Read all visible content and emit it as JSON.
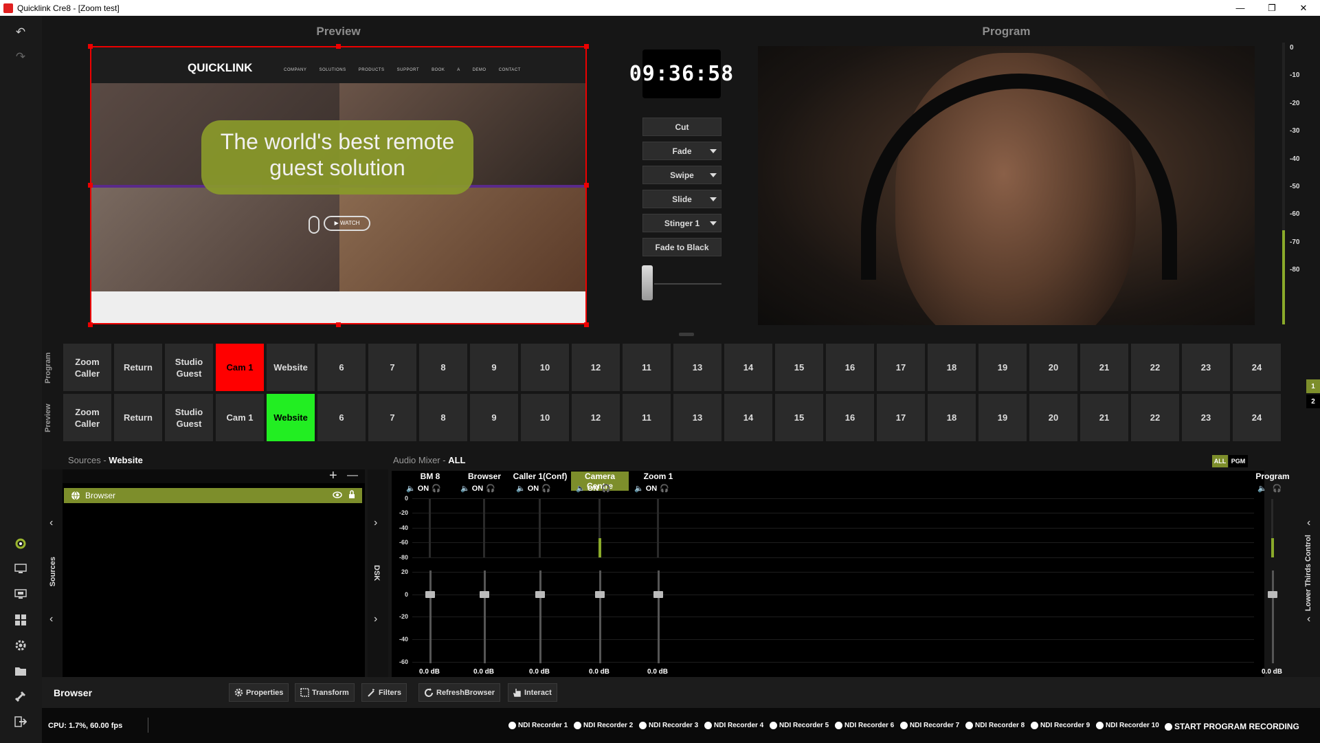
{
  "window": {
    "title": "Quicklink Cre8  - [Zoom test]",
    "minimize": "—",
    "maximize": "❐",
    "close": "✕"
  },
  "left_toolbar": {
    "undo": "↶",
    "redo": "↷"
  },
  "preview": {
    "title": "Preview",
    "site_logo": "QUICKLINK",
    "site_nav": "COMPANY SOLUTIONS PRODUCTS SUPPORT BOOK A DEMO CONTACT",
    "headline": "The world's best remote guest solution",
    "watch_button": "▶ WATCH"
  },
  "program": {
    "title": "Program"
  },
  "clock": "09:36:58",
  "transitions": {
    "cut": "Cut",
    "fade": "Fade",
    "swipe": "Swipe",
    "slide": "Slide",
    "stinger": "Stinger 1",
    "fade_to_black": "Fade to Black",
    "tbar_level": 0
  },
  "vu_scale": [
    "0",
    "-10",
    "-20",
    "-30",
    "-40",
    "-50",
    "-60",
    "-70",
    "-80"
  ],
  "program_level_db": -56,
  "grid": {
    "program_label": "Program",
    "preview_label": "Preview",
    "buttons": [
      "Zoom Caller",
      "Return",
      "Studio Guest",
      "Cam 1",
      "Website",
      "6",
      "7",
      "8",
      "9",
      "10",
      "12",
      "11",
      "13",
      "14",
      "15",
      "16",
      "17",
      "18",
      "19",
      "20",
      "21",
      "22",
      "23",
      "24"
    ],
    "program_active": "Cam 1",
    "preview_active": "Website",
    "program_color": "#ff0000",
    "preview_color": "#22ee22",
    "pages": [
      "1",
      "2"
    ]
  },
  "sources": {
    "label": "Sources",
    "scene": "Website",
    "sidebar_label": "Sources",
    "add": "+",
    "remove": "—",
    "items": [
      {
        "name": "Browser"
      }
    ]
  },
  "dsk_label": "DSK",
  "lower_thirds_label": "Lower Thirds Control",
  "audio": {
    "label": "Audio Mixer",
    "filter": "ALL",
    "tabs": [
      "ALL",
      "PGM"
    ],
    "on_label": "ON",
    "meter_scale": [
      "0",
      "-20",
      "-40",
      "-60",
      "-80"
    ],
    "fader_scale": [
      "20",
      "0",
      "-20",
      "-40",
      "-60"
    ],
    "channels": [
      {
        "name": "BM 8",
        "db": "0.0 dB"
      },
      {
        "name": "Browser",
        "db": "0.0 dB"
      },
      {
        "name": "Caller 1(Conf)",
        "db": "0.0 dB"
      },
      {
        "name": "Camera Centre",
        "db": "0.0 dB"
      },
      {
        "name": "Zoom 1",
        "db": "0.0 dB"
      }
    ],
    "program": {
      "name": "Program",
      "db": "0.0 dB"
    }
  },
  "bottom": {
    "selected": "Browser",
    "properties": "Properties",
    "transform": "Transform",
    "filters": "Filters",
    "refresh": "RefreshBrowser",
    "interact": "Interact"
  },
  "status": {
    "cpu": "CPU: 1.7%, 60.00 fps",
    "recorders": [
      "NDI Recorder 1",
      "NDI Recorder 2",
      "NDI Recorder 3",
      "NDI Recorder 4",
      "NDI Recorder 5",
      "NDI Recorder 6",
      "NDI Recorder 7",
      "NDI Recorder 8",
      "NDI Recorder 9",
      "NDI Recorder 10"
    ],
    "start_recording": "START PROGRAM RECORDING"
  },
  "accent": "#7d8e2b"
}
